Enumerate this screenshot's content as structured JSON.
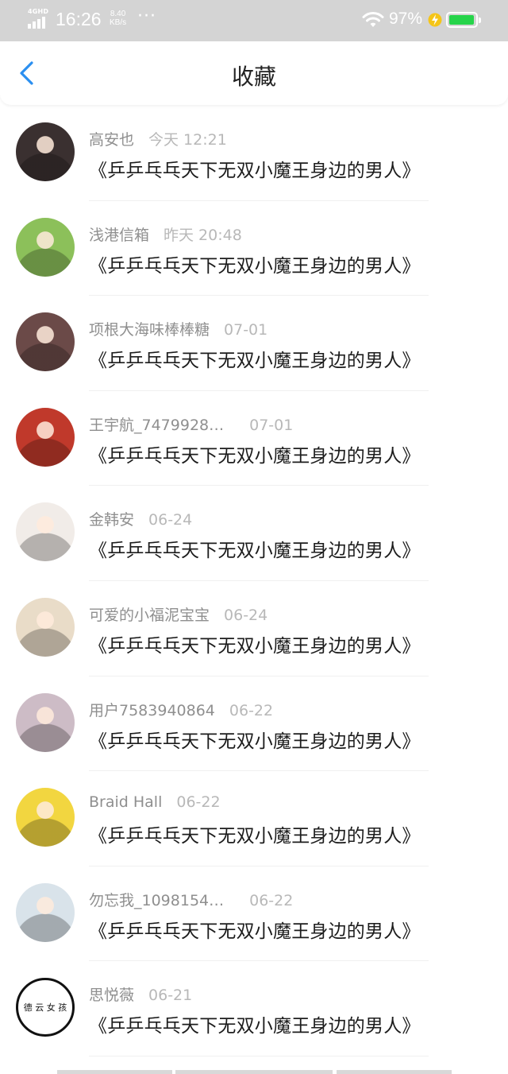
{
  "status_bar": {
    "network": "4GHD",
    "time": "16:26",
    "speed_value": "8.40",
    "speed_unit": "KB/s",
    "more": "···",
    "battery_percent": "97%",
    "battery_level": 0.97,
    "colors": {
      "background": "#d4d4d4",
      "battery_fill": "#26d44a",
      "charging_bolt": "#f5c518"
    }
  },
  "header": {
    "title": "收藏",
    "back_icon": "chevron-left-icon",
    "accent_color": "#2b8ff0"
  },
  "favorites": [
    {
      "user": "高安也",
      "time": "今天 12:21",
      "title": "《乒乒乓乓天下无双小魔王身边的男人》",
      "avatar_color": "#3a3030"
    },
    {
      "user": "浅港信箱",
      "time": "昨天 20:48",
      "title": "《乒乒乓乓天下无双小魔王身边的男人》",
      "avatar_color": "#8cc05a"
    },
    {
      "user": "项根大海味棒棒糖",
      "time": "07-01",
      "title": "《乒乒乓乓天下无双小魔王身边的男人》",
      "avatar_color": "#6b4a48"
    },
    {
      "user": "王宇航_7479928…",
      "time": "07-01",
      "title": "《乒乒乓乓天下无双小魔王身边的男人》",
      "avatar_color": "#c0392b"
    },
    {
      "user": "金韩安",
      "time": "06-24",
      "title": "《乒乒乓乓天下无双小魔王身边的男人》",
      "avatar_color": "#f1ece8"
    },
    {
      "user": "可爱的小福泥宝宝",
      "time": "06-24",
      "title": "《乒乒乓乓天下无双小魔王身边的男人》",
      "avatar_color": "#e9dcc8"
    },
    {
      "user": "用户7583940864",
      "time": "06-22",
      "title": "《乒乒乓乓天下无双小魔王身边的男人》",
      "avatar_color": "#cdbcc6"
    },
    {
      "user": "Braid Hall",
      "time": "06-22",
      "title": "《乒乒乓乓天下无双小魔王身边的男人》",
      "avatar_color": "#f2d640"
    },
    {
      "user": "勿忘我_1098154…",
      "time": "06-22",
      "title": "《乒乒乓乓天下无双小魔王身边的男人》",
      "avatar_color": "#d9e3ea"
    },
    {
      "user": "思悦薇",
      "time": "06-21",
      "title": "《乒乒乓乓天下无双小魔王身边的男人》",
      "avatar_color": "#ffffff",
      "avatar_text": "德 云 女 孩"
    }
  ]
}
